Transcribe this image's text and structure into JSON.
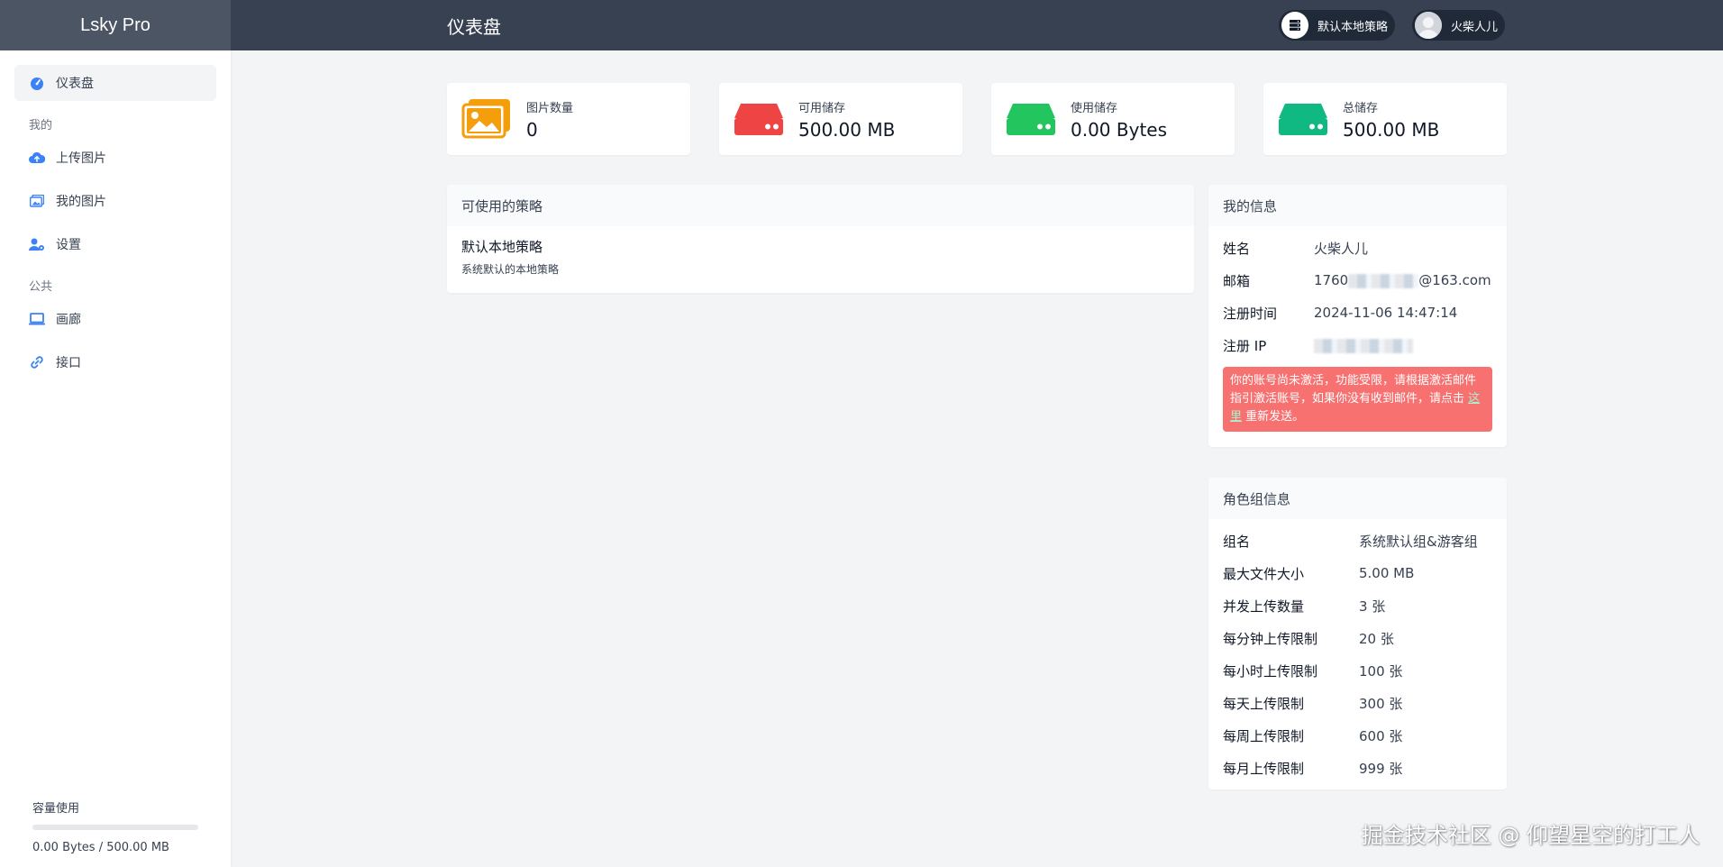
{
  "sidebar": {
    "brand": "Lsky Pro",
    "items": [
      {
        "label": "仪表盘",
        "icon": "dashboard-icon"
      },
      {
        "label": "上传图片",
        "icon": "cloud-upload-icon"
      },
      {
        "label": "我的图片",
        "icon": "images-icon"
      },
      {
        "label": "设置",
        "icon": "user-gear-icon"
      },
      {
        "label": "画廊",
        "icon": "laptop-icon"
      },
      {
        "label": "接口",
        "icon": "link-icon"
      }
    ],
    "section_mine": "我的",
    "section_public": "公共",
    "capacity": {
      "label": "容量使用",
      "text": "0.00 Bytes / 500.00 MB",
      "fraction": 0.0
    }
  },
  "header": {
    "title": "仪表盘",
    "strategy_label": "默认本地策略",
    "username": "火柴人儿"
  },
  "stats": [
    {
      "label": "图片数量",
      "value": "0",
      "icon": "images-icon",
      "color": "#f59e0b"
    },
    {
      "label": "可用储存",
      "value": "500.00 MB",
      "icon": "hdd-icon",
      "color": "#ef4444"
    },
    {
      "label": "使用储存",
      "value": "0.00 Bytes",
      "icon": "hdd-icon",
      "color": "#22c55e"
    },
    {
      "label": "总储存",
      "value": "500.00 MB",
      "icon": "hdd-icon",
      "color": "#10b981"
    }
  ],
  "strategies": {
    "title": "可使用的策略",
    "items": [
      {
        "name": "默认本地策略",
        "desc": "系统默认的本地策略"
      }
    ]
  },
  "my_info": {
    "title": "我的信息",
    "name_label": "姓名",
    "name": "火柴人儿",
    "email_label": "邮箱",
    "email_prefix": "1760",
    "email_suffix": "@163.com",
    "reg_time_label": "注册时间",
    "reg_time": "2024-11-06 14:47:14",
    "reg_ip_label": "注册 IP",
    "alert_pre": "你的账号尚未激活，功能受限，请根据激活邮件指引激活账号，如果你没有收到邮件，请点击 ",
    "alert_link": "这里",
    "alert_post": " 重新发送。"
  },
  "role_info": {
    "title": "角色组信息",
    "rows": [
      {
        "k": "组名",
        "v": "系统默认组&游客组"
      },
      {
        "k": "最大文件大小",
        "v": "5.00 MB"
      },
      {
        "k": "并发上传数量",
        "v": "3 张"
      },
      {
        "k": "每分钟上传限制",
        "v": "20 张"
      },
      {
        "k": "每小时上传限制",
        "v": "100 张"
      },
      {
        "k": "每天上传限制",
        "v": "300 张"
      },
      {
        "k": "每周上传限制",
        "v": "600 张"
      },
      {
        "k": "每月上传限制",
        "v": "999 张"
      }
    ]
  },
  "watermark": "掘金技术社区 @ 仰望星空的打工人"
}
